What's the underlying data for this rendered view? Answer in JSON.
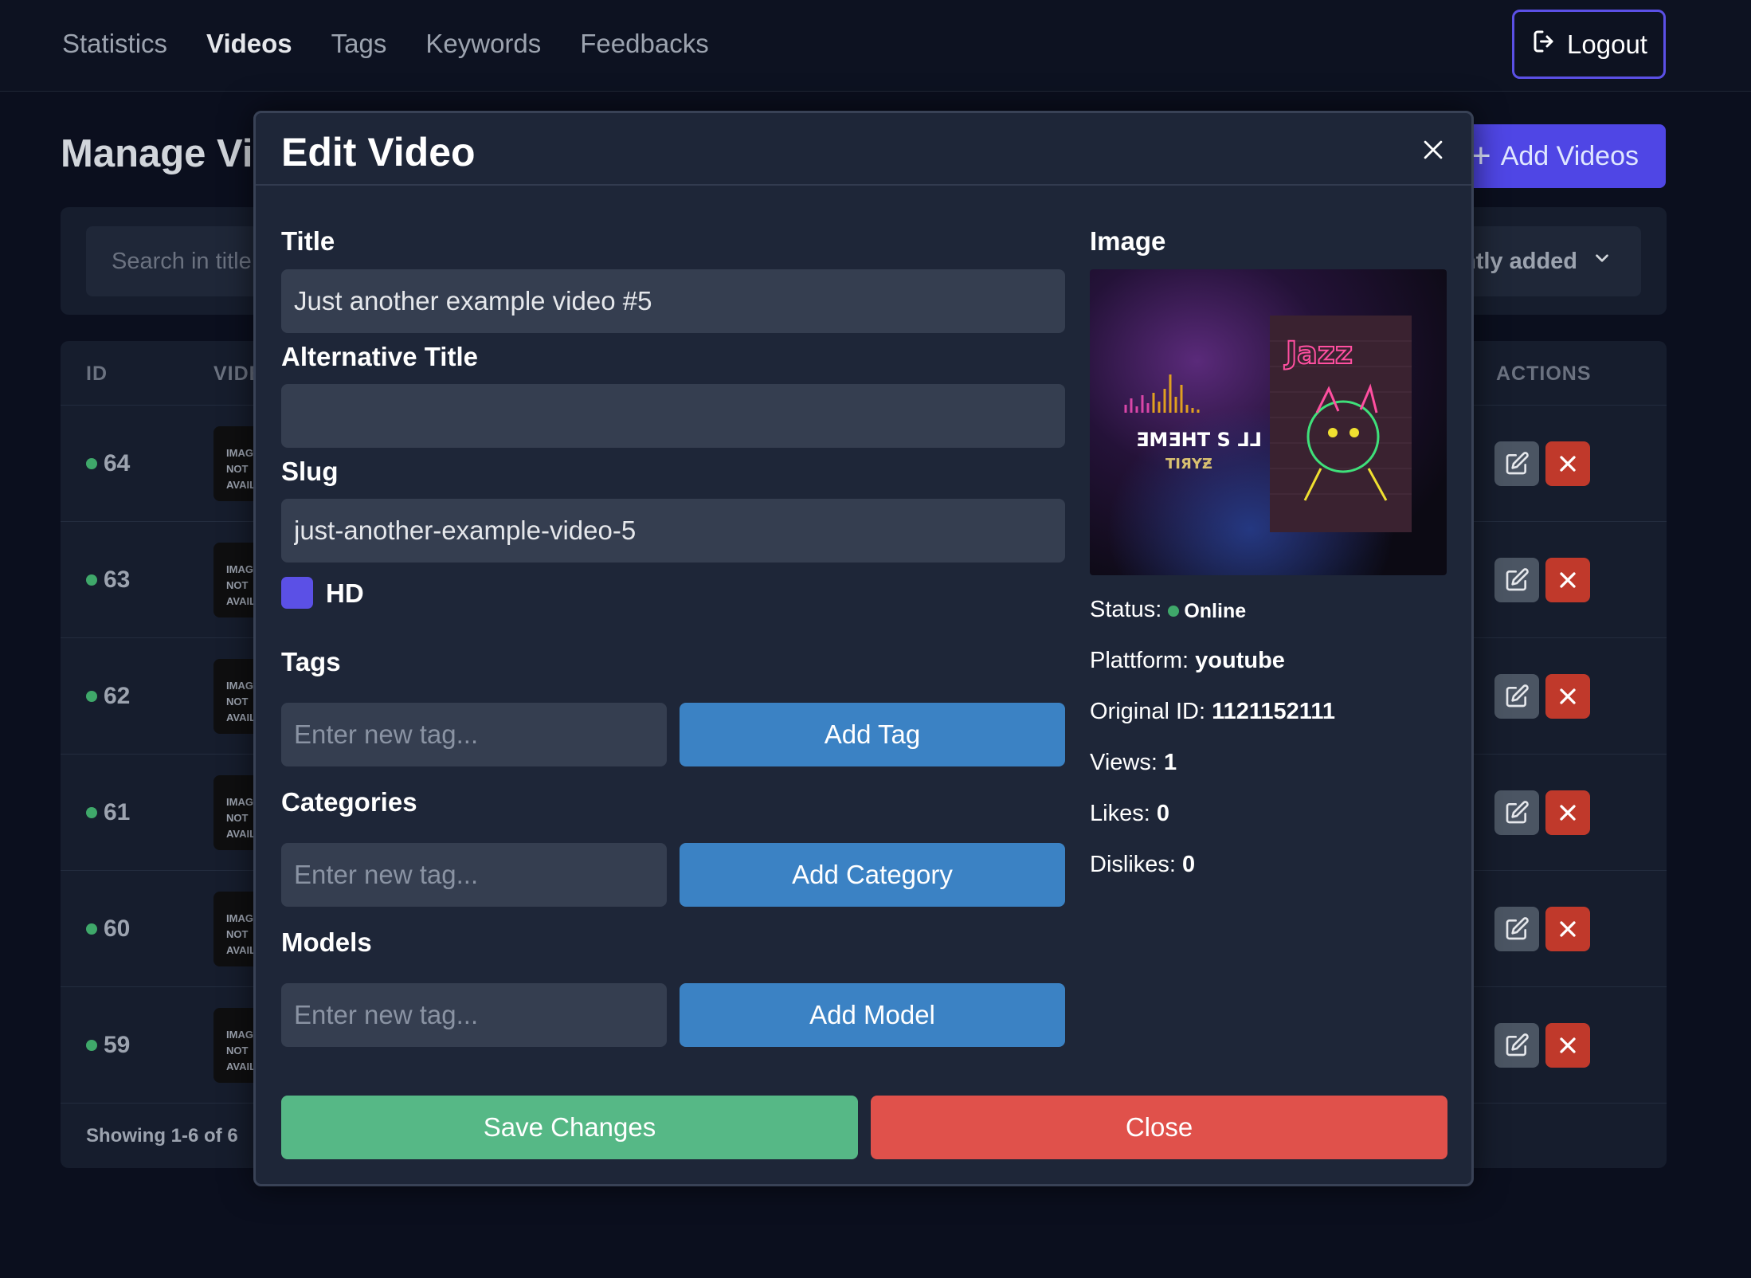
{
  "nav": {
    "links": [
      {
        "label": "Statistics",
        "active": false
      },
      {
        "label": "Videos",
        "active": true
      },
      {
        "label": "Tags",
        "active": false
      },
      {
        "label": "Keywords",
        "active": false
      },
      {
        "label": "Feedbacks",
        "active": false
      }
    ],
    "logout_label": "Logout"
  },
  "page": {
    "title": "Manage Videos",
    "add_videos_label": "Add Videos",
    "search_placeholder": "Search in title",
    "sort_label": "Recently added"
  },
  "table": {
    "columns": {
      "id": "ID",
      "video": "VIDEO",
      "actions": "ACTIONS"
    },
    "rows": [
      {
        "id": "64",
        "thumb": "IMAGE NOT AVAILABLE"
      },
      {
        "id": "63",
        "thumb": "IMAGE NOT AVAILABLE"
      },
      {
        "id": "62",
        "thumb": "IMAGE NOT AVAILABLE"
      },
      {
        "id": "61",
        "thumb": "IMAGE NOT AVAILABLE"
      },
      {
        "id": "60",
        "thumb": "IMAGE NOT AVAILABLE"
      },
      {
        "id": "59",
        "thumb": "IMAGE NOT AVAILABLE"
      }
    ],
    "footer": "Showing 1-6 of 6"
  },
  "modal": {
    "title": "Edit Video",
    "title_label": "Title",
    "title_value": "Just another example video #5",
    "alt_title_label": "Alternative Title",
    "alt_title_value": "",
    "slug_label": "Slug",
    "slug_value": "just-another-example-video-5",
    "hd_label": "HD",
    "hd_checked": true,
    "tags_label": "Tags",
    "tags_placeholder": "Enter new tag...",
    "add_tag_label": "Add Tag",
    "categories_label": "Categories",
    "categories_placeholder": "Enter new tag...",
    "add_category_label": "Add Category",
    "models_label": "Models",
    "models_placeholder": "Enter new tag...",
    "add_model_label": "Add Model",
    "image_label": "Image",
    "info": {
      "status_label": "Status:",
      "status_value": "Online",
      "platform_label": "Plattform:",
      "platform_value": "youtube",
      "original_id_label": "Original ID:",
      "original_id_value": "1121152111",
      "views_label": "Views:",
      "views_value": "1",
      "likes_label": "Likes:",
      "likes_value": "0",
      "dislikes_label": "Dislikes:",
      "dislikes_value": "0"
    },
    "save_label": "Save Changes",
    "close_label": "Close"
  },
  "colors": {
    "accent": "#4f46e5",
    "online": "#3fa86a",
    "save": "#56b886",
    "close": "#e0514b",
    "add_button": "#3b82c4"
  }
}
